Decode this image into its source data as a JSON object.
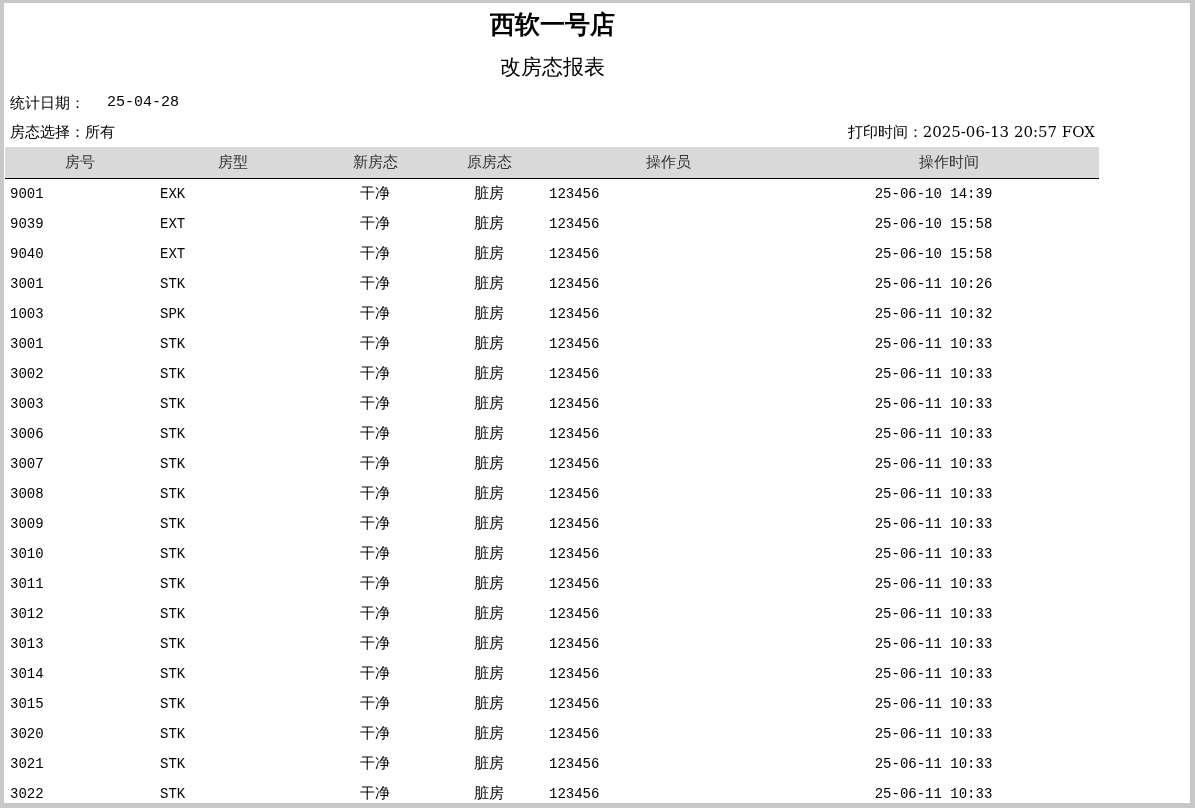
{
  "title": "西软一号店",
  "subtitle": "改房态报表",
  "stat_date": {
    "label": "统计日期：",
    "value": "25-04-28"
  },
  "status_filter": "房态选择：所有",
  "print_time": "打印时间：2025-06-13 20:57 FOX",
  "table": {
    "columns": [
      "房号",
      "房型",
      "新房态",
      "原房态",
      "操作员",
      "操作时间"
    ],
    "rows": [
      [
        "9001",
        "EXK",
        "干净",
        "脏房",
        "123456",
        "25-06-10 14:39"
      ],
      [
        "9039",
        "EXT",
        "干净",
        "脏房",
        "123456",
        "25-06-10 15:58"
      ],
      [
        "9040",
        "EXT",
        "干净",
        "脏房",
        "123456",
        "25-06-10 15:58"
      ],
      [
        "3001",
        "STK",
        "干净",
        "脏房",
        "123456",
        "25-06-11 10:26"
      ],
      [
        "1003",
        "SPK",
        "干净",
        "脏房",
        "123456",
        "25-06-11 10:32"
      ],
      [
        "3001",
        "STK",
        "干净",
        "脏房",
        "123456",
        "25-06-11 10:33"
      ],
      [
        "3002",
        "STK",
        "干净",
        "脏房",
        "123456",
        "25-06-11 10:33"
      ],
      [
        "3003",
        "STK",
        "干净",
        "脏房",
        "123456",
        "25-06-11 10:33"
      ],
      [
        "3006",
        "STK",
        "干净",
        "脏房",
        "123456",
        "25-06-11 10:33"
      ],
      [
        "3007",
        "STK",
        "干净",
        "脏房",
        "123456",
        "25-06-11 10:33"
      ],
      [
        "3008",
        "STK",
        "干净",
        "脏房",
        "123456",
        "25-06-11 10:33"
      ],
      [
        "3009",
        "STK",
        "干净",
        "脏房",
        "123456",
        "25-06-11 10:33"
      ],
      [
        "3010",
        "STK",
        "干净",
        "脏房",
        "123456",
        "25-06-11 10:33"
      ],
      [
        "3011",
        "STK",
        "干净",
        "脏房",
        "123456",
        "25-06-11 10:33"
      ],
      [
        "3012",
        "STK",
        "干净",
        "脏房",
        "123456",
        "25-06-11 10:33"
      ],
      [
        "3013",
        "STK",
        "干净",
        "脏房",
        "123456",
        "25-06-11 10:33"
      ],
      [
        "3014",
        "STK",
        "干净",
        "脏房",
        "123456",
        "25-06-11 10:33"
      ],
      [
        "3015",
        "STK",
        "干净",
        "脏房",
        "123456",
        "25-06-11 10:33"
      ],
      [
        "3020",
        "STK",
        "干净",
        "脏房",
        "123456",
        "25-06-11 10:33"
      ],
      [
        "3021",
        "STK",
        "干净",
        "脏房",
        "123456",
        "25-06-11 10:33"
      ],
      [
        "3022",
        "STK",
        "干净",
        "脏房",
        "123456",
        "25-06-11 10:33"
      ]
    ]
  }
}
